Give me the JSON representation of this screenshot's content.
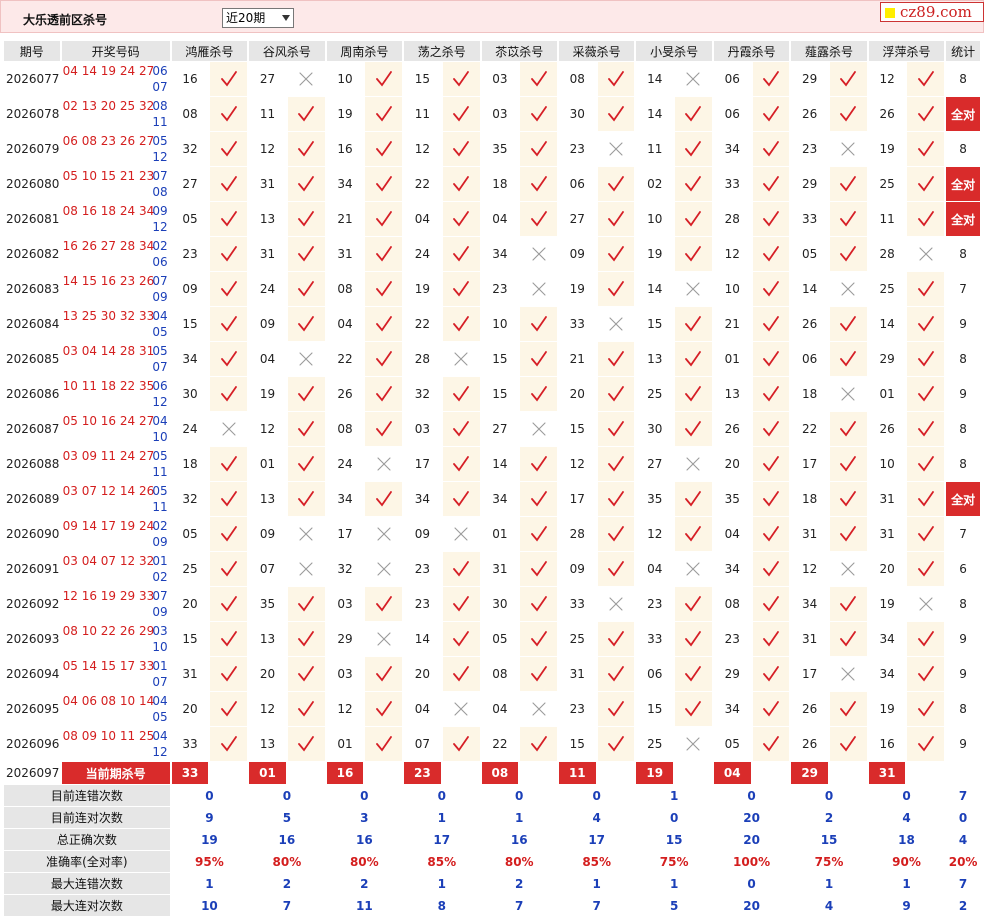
{
  "header": {
    "title": "大乐透前区杀号",
    "range_select": "近20期",
    "logo": "cz89.com"
  },
  "columns": {
    "issue": "期号",
    "draw": "开奖号码",
    "experts": [
      "鸿雁杀号",
      "谷风杀号",
      "周南杀号",
      "荡之杀号",
      "苶苡杀号",
      "采薇杀号",
      "小旻杀号",
      "丹霞杀号",
      "薤露杀号",
      "浮萍杀号"
    ],
    "stat": "统计"
  },
  "rows": [
    {
      "issue": "2026077",
      "front": "04 14 19 24 27",
      "back1": "06",
      "back2": "07",
      "kills": [
        "16",
        "27",
        "10",
        "15",
        "03",
        "08",
        "14",
        "06",
        "29",
        "12"
      ],
      "ok": [
        1,
        0,
        1,
        1,
        1,
        1,
        0,
        1,
        1,
        1
      ],
      "stat": "8"
    },
    {
      "issue": "2026078",
      "front": "02 13 20 25 32",
      "back1": "08",
      "back2": "11",
      "kills": [
        "08",
        "11",
        "19",
        "11",
        "03",
        "30",
        "14",
        "06",
        "26",
        "26"
      ],
      "ok": [
        1,
        1,
        1,
        1,
        1,
        1,
        1,
        1,
        1,
        1
      ],
      "stat": "全对"
    },
    {
      "issue": "2026079",
      "front": "06 08 23 26 27",
      "back1": "05",
      "back2": "12",
      "kills": [
        "32",
        "12",
        "16",
        "12",
        "35",
        "23",
        "11",
        "34",
        "23",
        "19"
      ],
      "ok": [
        1,
        1,
        1,
        1,
        1,
        0,
        1,
        1,
        0,
        1
      ],
      "stat": "8"
    },
    {
      "issue": "2026080",
      "front": "05 10 15 21 23",
      "back1": "07",
      "back2": "08",
      "kills": [
        "27",
        "31",
        "34",
        "22",
        "18",
        "06",
        "02",
        "33",
        "29",
        "25"
      ],
      "ok": [
        1,
        1,
        1,
        1,
        1,
        1,
        1,
        1,
        1,
        1
      ],
      "stat": "全对"
    },
    {
      "issue": "2026081",
      "front": "08 16 18 24 34",
      "back1": "09",
      "back2": "12",
      "kills": [
        "05",
        "13",
        "21",
        "04",
        "04",
        "27",
        "10",
        "28",
        "33",
        "11"
      ],
      "ok": [
        1,
        1,
        1,
        1,
        1,
        1,
        1,
        1,
        1,
        1
      ],
      "stat": "全对"
    },
    {
      "issue": "2026082",
      "front": "16 26 27 28 34",
      "back1": "02",
      "back2": "06",
      "kills": [
        "23",
        "31",
        "31",
        "24",
        "34",
        "09",
        "19",
        "12",
        "05",
        "28"
      ],
      "ok": [
        1,
        1,
        1,
        1,
        0,
        1,
        1,
        1,
        1,
        0
      ],
      "stat": "8"
    },
    {
      "issue": "2026083",
      "front": "14 15 16 23 26",
      "back1": "07",
      "back2": "09",
      "kills": [
        "09",
        "24",
        "08",
        "19",
        "23",
        "19",
        "14",
        "10",
        "14",
        "25"
      ],
      "ok": [
        1,
        1,
        1,
        1,
        0,
        1,
        0,
        1,
        0,
        1
      ],
      "stat": "7"
    },
    {
      "issue": "2026084",
      "front": "13 25 30 32 33",
      "back1": "04",
      "back2": "05",
      "kills": [
        "15",
        "09",
        "04",
        "22",
        "10",
        "33",
        "15",
        "21",
        "26",
        "14"
      ],
      "ok": [
        1,
        1,
        1,
        1,
        1,
        0,
        1,
        1,
        1,
        1
      ],
      "stat": "9"
    },
    {
      "issue": "2026085",
      "front": "03 04 14 28 31",
      "back1": "05",
      "back2": "07",
      "kills": [
        "34",
        "04",
        "22",
        "28",
        "15",
        "21",
        "13",
        "01",
        "06",
        "29"
      ],
      "ok": [
        1,
        0,
        1,
        0,
        1,
        1,
        1,
        1,
        1,
        1
      ],
      "stat": "8"
    },
    {
      "issue": "2026086",
      "front": "10 11 18 22 35",
      "back1": "06",
      "back2": "12",
      "kills": [
        "30",
        "19",
        "26",
        "32",
        "15",
        "20",
        "25",
        "13",
        "18",
        "01"
      ],
      "ok": [
        1,
        1,
        1,
        1,
        1,
        1,
        1,
        1,
        0,
        1
      ],
      "stat": "9"
    },
    {
      "issue": "2026087",
      "front": "05 10 16 24 27",
      "back1": "04",
      "back2": "10",
      "kills": [
        "24",
        "12",
        "08",
        "03",
        "27",
        "15",
        "30",
        "26",
        "22",
        "26"
      ],
      "ok": [
        0,
        1,
        1,
        1,
        0,
        1,
        1,
        1,
        1,
        1
      ],
      "stat": "8"
    },
    {
      "issue": "2026088",
      "front": "03 09 11 24 27",
      "back1": "05",
      "back2": "11",
      "kills": [
        "18",
        "01",
        "24",
        "17",
        "14",
        "12",
        "27",
        "20",
        "17",
        "10"
      ],
      "ok": [
        1,
        1,
        0,
        1,
        1,
        1,
        0,
        1,
        1,
        1
      ],
      "stat": "8"
    },
    {
      "issue": "2026089",
      "front": "03 07 12 14 26",
      "back1": "05",
      "back2": "11",
      "kills": [
        "32",
        "13",
        "34",
        "34",
        "34",
        "17",
        "35",
        "35",
        "18",
        "31"
      ],
      "ok": [
        1,
        1,
        1,
        1,
        1,
        1,
        1,
        1,
        1,
        1
      ],
      "stat": "全对"
    },
    {
      "issue": "2026090",
      "front": "09 14 17 19 24",
      "back1": "02",
      "back2": "09",
      "kills": [
        "05",
        "09",
        "17",
        "09",
        "01",
        "28",
        "12",
        "04",
        "31",
        "31"
      ],
      "ok": [
        1,
        0,
        0,
        0,
        1,
        1,
        1,
        1,
        1,
        1
      ],
      "stat": "7"
    },
    {
      "issue": "2026091",
      "front": "03 04 07 12 32",
      "back1": "01",
      "back2": "02",
      "kills": [
        "25",
        "07",
        "32",
        "23",
        "31",
        "09",
        "04",
        "34",
        "12",
        "20"
      ],
      "ok": [
        1,
        0,
        0,
        1,
        1,
        1,
        0,
        1,
        0,
        1
      ],
      "stat": "6"
    },
    {
      "issue": "2026092",
      "front": "12 16 19 29 33",
      "back1": "07",
      "back2": "09",
      "kills": [
        "20",
        "35",
        "03",
        "23",
        "30",
        "33",
        "23",
        "08",
        "34",
        "19"
      ],
      "ok": [
        1,
        1,
        1,
        1,
        1,
        0,
        1,
        1,
        1,
        0
      ],
      "stat": "8"
    },
    {
      "issue": "2026093",
      "front": "08 10 22 26 29",
      "back1": "03",
      "back2": "10",
      "kills": [
        "15",
        "13",
        "29",
        "14",
        "05",
        "25",
        "33",
        "23",
        "31",
        "34"
      ],
      "ok": [
        1,
        1,
        0,
        1,
        1,
        1,
        1,
        1,
        1,
        1
      ],
      "stat": "9"
    },
    {
      "issue": "2026094",
      "front": "05 14 15 17 33",
      "back1": "01",
      "back2": "07",
      "kills": [
        "31",
        "20",
        "03",
        "20",
        "08",
        "31",
        "06",
        "29",
        "17",
        "34"
      ],
      "ok": [
        1,
        1,
        1,
        1,
        1,
        1,
        1,
        1,
        0,
        1
      ],
      "stat": "9"
    },
    {
      "issue": "2026095",
      "front": "04 06 08 10 14",
      "back1": "04",
      "back2": "05",
      "kills": [
        "20",
        "12",
        "12",
        "04",
        "04",
        "23",
        "15",
        "34",
        "26",
        "19"
      ],
      "ok": [
        1,
        1,
        1,
        0,
        0,
        1,
        1,
        1,
        1,
        1
      ],
      "stat": "8"
    },
    {
      "issue": "2026096",
      "front": "08 09 10 11 25",
      "back1": "04",
      "back2": "12",
      "kills": [
        "33",
        "13",
        "01",
        "07",
        "22",
        "15",
        "25",
        "05",
        "26",
        "16"
      ],
      "ok": [
        1,
        1,
        1,
        1,
        1,
        1,
        0,
        1,
        1,
        1
      ],
      "stat": "9"
    }
  ],
  "current": {
    "issue": "2026097",
    "label": "当前期杀号",
    "kills": [
      "33",
      "01",
      "16",
      "23",
      "08",
      "11",
      "19",
      "04",
      "29",
      "31"
    ]
  },
  "summary": [
    {
      "label": "目前连错次数",
      "values": [
        "0",
        "0",
        "0",
        "0",
        "0",
        "0",
        "1",
        "0",
        "0",
        "0",
        "7"
      ]
    },
    {
      "label": "目前连对次数",
      "values": [
        "9",
        "5",
        "3",
        "1",
        "1",
        "4",
        "0",
        "20",
        "2",
        "4",
        "0"
      ]
    },
    {
      "label": "总正确次数",
      "values": [
        "19",
        "16",
        "16",
        "17",
        "16",
        "17",
        "15",
        "20",
        "15",
        "18",
        "4"
      ]
    },
    {
      "label": "准确率(全对率)",
      "values": [
        "95%",
        "80%",
        "80%",
        "85%",
        "80%",
        "85%",
        "75%",
        "100%",
        "75%",
        "90%",
        "20%"
      ]
    },
    {
      "label": "最大连错次数",
      "values": [
        "1",
        "2",
        "2",
        "1",
        "2",
        "1",
        "1",
        "0",
        "1",
        "1",
        "7"
      ]
    },
    {
      "label": "最大连对次数",
      "values": [
        "10",
        "7",
        "11",
        "8",
        "7",
        "7",
        "5",
        "20",
        "4",
        "9",
        "2"
      ]
    }
  ],
  "colors": {
    "check": "#d61f26",
    "cross": "#9a9a9a",
    "accent": "#d92b2b",
    "blue": "#1b3fb8",
    "header_bg": "#e6e6e6"
  }
}
